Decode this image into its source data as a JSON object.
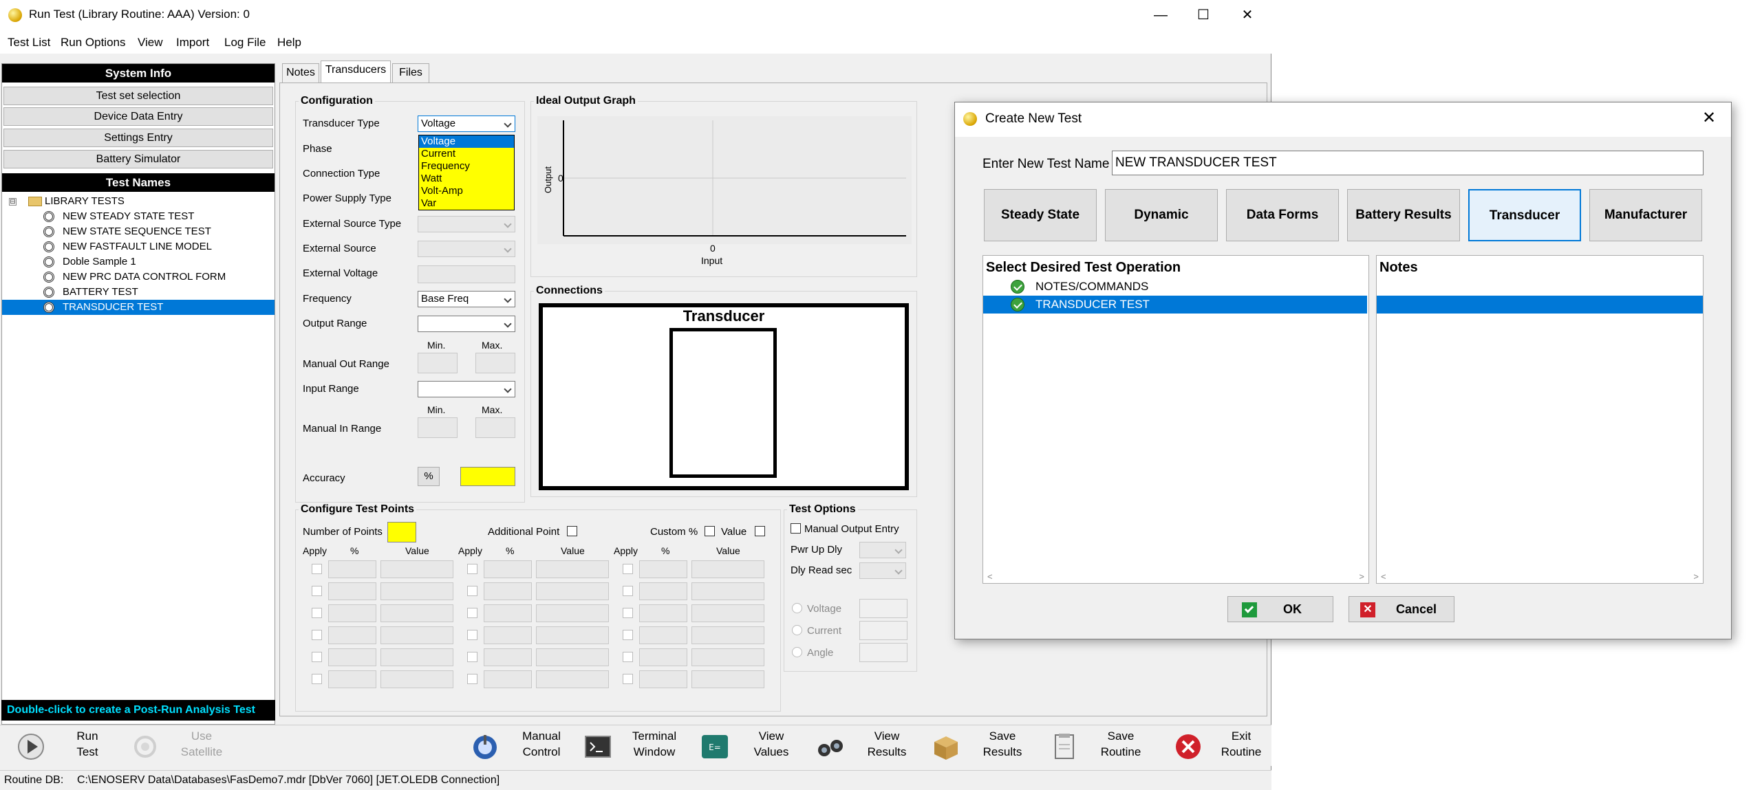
{
  "main_window": {
    "title": "Run Test (Library Routine: AAA)  Version: 0",
    "caption": {
      "minimize": "—",
      "maximize": "☐",
      "close": "✕"
    },
    "menu": [
      "Test List",
      "Run Options",
      "View",
      "Import",
      "Log File",
      "Help"
    ]
  },
  "left_panel": {
    "system_info_title": "System Info",
    "system_buttons": [
      "Test set selection",
      "Device Data Entry",
      "Settings Entry",
      "Battery Simulator"
    ],
    "test_names_title": "Test Names",
    "tree_expander": "⊟",
    "tree_root": "LIBRARY TESTS",
    "tests": [
      "NEW STEADY STATE TEST",
      "NEW STATE SEQUENCE TEST",
      "NEW FASTFAULT LINE MODEL",
      "Doble Sample 1",
      "NEW PRC DATA CONTROL FORM",
      "BATTERY TEST",
      "TRANSDUCER TEST"
    ],
    "selected_test": "TRANSDUCER TEST",
    "hint": "Double-click to create a Post-Run Analysis Test"
  },
  "tabs": [
    "Notes",
    "Transducers",
    "Files"
  ],
  "active_tab": "Transducers",
  "configuration": {
    "title": "Configuration",
    "transducer_type_label": "Transducer Type",
    "transducer_type_value": "Voltage",
    "transducer_type_options": [
      "Voltage",
      "Current",
      "Frequency",
      "Watt",
      "Volt-Amp",
      "Var"
    ],
    "phase_label": "Phase",
    "connection_type_label": "Connection Type",
    "power_supply_type_label": "Power Supply Type",
    "external_source_type_label": "External Source Type",
    "external_source_label": "External Source",
    "external_voltage_label": "External Voltage",
    "frequency_label": "Frequency",
    "frequency_value": "Base Freq",
    "output_range_label": "Output Range",
    "min_label": "Min.",
    "max_label": "Max.",
    "manual_out_range_label": "Manual Out Range",
    "input_range_label": "Input Range",
    "manual_in_range_label": "Manual In Range",
    "accuracy_label": "Accuracy",
    "accuracy_unit": "%"
  },
  "ideal_output_graph": {
    "title": "Ideal Output Graph",
    "y_label": "Output",
    "y_tick": "0",
    "x_tick": "0",
    "x_label": "Input"
  },
  "connections": {
    "title": "Connections",
    "diagram_label": "Transducer"
  },
  "test_points": {
    "title": "Configure Test Points",
    "number_of_points_label": "Number of Points",
    "additional_point_label": "Additional Point",
    "custom_pct_label": "Custom %",
    "value_label": "Value",
    "col_apply": "Apply",
    "col_pct": "%",
    "col_value": "Value"
  },
  "test_options": {
    "title": "Test Options",
    "manual_output_entry": "Manual Output Entry",
    "pwr_up_dly": "Pwr Up Dly",
    "dly_read_sec": "Dly Read sec",
    "radio_voltage": "Voltage",
    "radio_current": "Current",
    "radio_angle": "Angle"
  },
  "toolbar": [
    {
      "name": "run-test",
      "line1": "Run",
      "line2": "Test",
      "enabled": true
    },
    {
      "name": "use-satellite",
      "line1": "Use",
      "line2": "Satellite",
      "enabled": false
    },
    {
      "name": "manual-control",
      "line1": "Manual",
      "line2": "Control",
      "enabled": true
    },
    {
      "name": "terminal-window",
      "line1": "Terminal",
      "line2": "Window",
      "enabled": true
    },
    {
      "name": "view-values",
      "line1": "View",
      "line2": "Values",
      "enabled": true
    },
    {
      "name": "view-results",
      "line1": "View",
      "line2": "Results",
      "enabled": true
    },
    {
      "name": "save-results",
      "line1": "Save",
      "line2": "Results",
      "enabled": true
    },
    {
      "name": "save-routine",
      "line1": "Save",
      "line2": "Routine",
      "enabled": true
    },
    {
      "name": "exit-routine",
      "line1": "Exit",
      "line2": "Routine",
      "enabled": true
    }
  ],
  "status_bar": {
    "label": "Routine DB:",
    "path": "C:\\ENOSERV Data\\Databases\\FasDemo7.mdr  [DbVer 7060]  [JET.OLEDB Connection]"
  },
  "dialog": {
    "title": "Create New Test",
    "close": "✕",
    "name_label": "Enter New Test Name",
    "name_value": "NEW TRANSDUCER TEST",
    "categories": [
      "Steady State",
      "Dynamic",
      "Data Forms",
      "Battery Results",
      "Transducer",
      "Manufacturer"
    ],
    "selected_category": "Transducer",
    "list_header": "Select Desired Test Operation",
    "notes_header": "Notes",
    "operations": [
      "NOTES/COMMANDS",
      "TRANSDUCER TEST"
    ],
    "selected_operation": "TRANSDUCER TEST",
    "scroll_left": "<",
    "scroll_right": ">",
    "ok_label": "OK",
    "cancel_label": "Cancel"
  },
  "colors": {
    "selection": "#0078d7",
    "highlight_yellow": "#ffff00",
    "hint_text": "#00e0ff"
  }
}
